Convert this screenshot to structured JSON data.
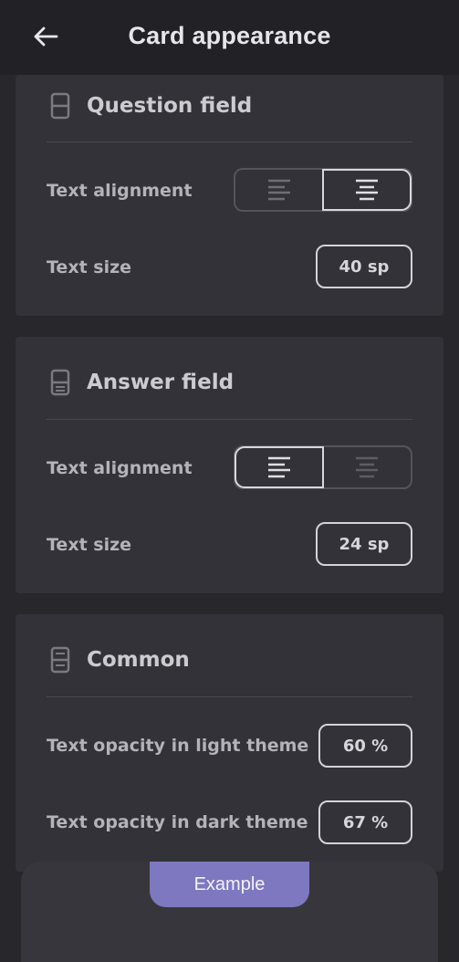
{
  "header": {
    "title": "Card appearance",
    "back_icon": "arrow-left-icon"
  },
  "question_field": {
    "title": "Question field",
    "icon": "card-field-icon",
    "text_alignment_label": "Text alignment",
    "alignment_options": [
      "left",
      "center"
    ],
    "alignment_selected": "center",
    "text_size_label": "Text size",
    "text_size_value": "40 sp"
  },
  "answer_field": {
    "title": "Answer field",
    "icon": "card-field-icon",
    "text_alignment_label": "Text alignment",
    "alignment_options": [
      "left",
      "center"
    ],
    "alignment_selected": "left",
    "text_size_label": "Text size",
    "text_size_value": "24 sp"
  },
  "common": {
    "title": "Common",
    "icon": "card-field-icon",
    "light_opacity_label": "Text opacity in light theme",
    "light_opacity_value": "60 %",
    "dark_opacity_label": "Text opacity in dark theme",
    "dark_opacity_value": "67 %"
  },
  "example": {
    "button_label": "Example"
  },
  "colors": {
    "background": "#27272c",
    "card": "#333238",
    "accent": "#7e78c0"
  }
}
